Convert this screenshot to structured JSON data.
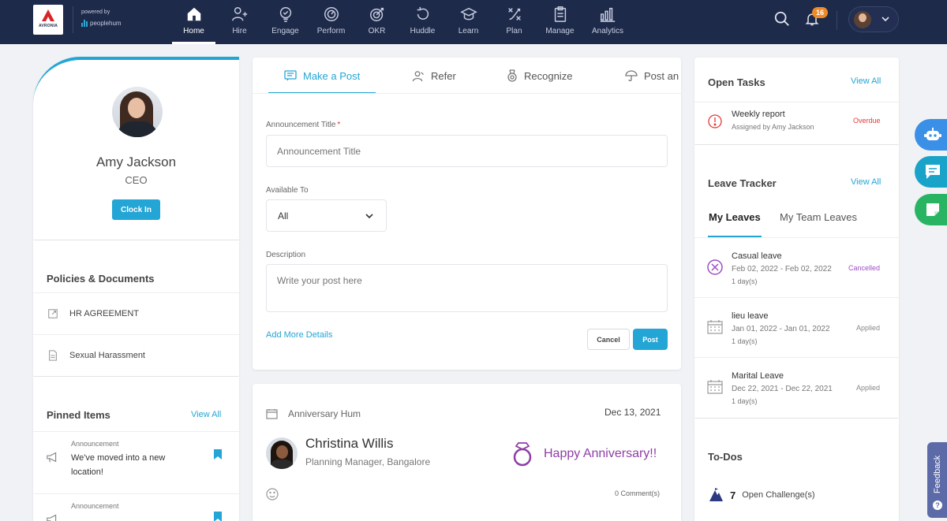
{
  "brand": {
    "logo_text": "AVRONIA",
    "powered_by": "powered by",
    "partner": "peoplehum"
  },
  "nav": [
    {
      "label": "Home",
      "icon": "home-icon"
    },
    {
      "label": "Hire",
      "icon": "person-add-icon"
    },
    {
      "label": "Engage",
      "icon": "engage-icon"
    },
    {
      "label": "Perform",
      "icon": "gauge-icon"
    },
    {
      "label": "OKR",
      "icon": "target-icon"
    },
    {
      "label": "Huddle",
      "icon": "huddle-icon"
    },
    {
      "label": "Learn",
      "icon": "graduation-cap-icon"
    },
    {
      "label": "Plan",
      "icon": "plan-icon"
    },
    {
      "label": "Manage",
      "icon": "clipboard-icon"
    },
    {
      "label": "Analytics",
      "icon": "bar-chart-icon"
    }
  ],
  "header": {
    "notification_count": "16"
  },
  "profile": {
    "name": "Amy Jackson",
    "role": "CEO",
    "clock_in_label": "Clock In"
  },
  "policies": {
    "title": "Policies & Documents",
    "items": [
      "HR AGREEMENT",
      "Sexual Harassment"
    ]
  },
  "pinned": {
    "title": "Pinned Items",
    "view_all": "View All",
    "items": [
      {
        "kind": "Announcement",
        "text": "We've moved into a new location!"
      },
      {
        "kind": "Announcement",
        "text": ""
      }
    ]
  },
  "post": {
    "tabs": [
      "Make a Post",
      "Refer",
      "Recognize",
      "Post an"
    ],
    "title_label": "Announcement Title",
    "title_placeholder": "Announcement Title",
    "available_label": "Available To",
    "available_value": "All",
    "desc_label": "Description",
    "desc_placeholder": "Write your post here",
    "add_more": "Add More Details",
    "cancel": "Cancel",
    "submit": "Post"
  },
  "anniversary": {
    "header": "Anniversary Hum",
    "date": "Dec 13, 2021",
    "person": "Christina Willis",
    "desc": "Planning Manager, Bangalore",
    "message": "Happy Anniversary!!",
    "comments": "0 Comment(s)"
  },
  "tasks": {
    "title": "Open Tasks",
    "view_all": "View All",
    "item_title": "Weekly report",
    "item_sub": "Assigned by Amy Jackson",
    "item_status": "Overdue"
  },
  "leave": {
    "title": "Leave Tracker",
    "view_all": "View All",
    "tab_mine": "My Leaves",
    "tab_team": "My Team Leaves",
    "items": [
      {
        "name": "Casual leave",
        "dates": "Feb 02, 2022 - Feb 02, 2022",
        "count": "1 day(s)",
        "status": "Cancelled"
      },
      {
        "name": "lieu leave",
        "dates": "Jan 01, 2022 - Jan 01, 2022",
        "count": "1 day(s)",
        "status": "Applied"
      },
      {
        "name": "Marital Leave",
        "dates": "Dec 22, 2021 - Dec 22, 2021",
        "count": "1 day(s)",
        "status": "Applied"
      }
    ]
  },
  "todos": {
    "title": "To-Dos",
    "count": "7",
    "label": "Open Challenge(s)"
  },
  "feedback": {
    "label": "Feedback"
  },
  "colors": {
    "nav_bg": "#1e2a4a",
    "accent": "#23a5d5",
    "overdue": "#e53935",
    "cancelled": "#9c4fc6",
    "anniversary": "#8e3fa6"
  }
}
